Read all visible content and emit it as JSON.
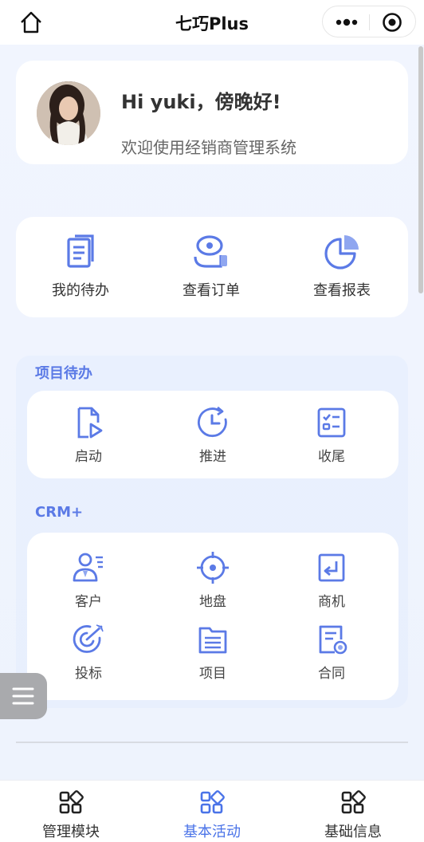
{
  "header": {
    "title": "七巧Plus",
    "more_icon": "more-dots-icon",
    "target_icon": "target-icon",
    "home_icon": "home-icon"
  },
  "greeting": {
    "title": "Hi yuki，傍晚好!",
    "subtitle": "欢迎使用经销商管理系统"
  },
  "quick_actions": [
    {
      "label": "我的待办",
      "icon": "todo-document-icon"
    },
    {
      "label": "查看订单",
      "icon": "order-icon"
    },
    {
      "label": "查看报表",
      "icon": "pie-chart-icon"
    }
  ],
  "project_todo": {
    "title": "项目待办",
    "items": [
      {
        "label": "启动",
        "icon": "start-file-icon"
      },
      {
        "label": "推进",
        "icon": "clock-progress-icon"
      },
      {
        "label": "收尾",
        "icon": "checklist-icon"
      }
    ]
  },
  "crm": {
    "title": "CRM+",
    "items": [
      {
        "label": "客户",
        "icon": "customer-icon"
      },
      {
        "label": "地盘",
        "icon": "territory-target-icon"
      },
      {
        "label": "商机",
        "icon": "opportunity-icon"
      },
      {
        "label": "投标",
        "icon": "bid-icon"
      },
      {
        "label": "项目",
        "icon": "project-folder-icon"
      },
      {
        "label": "合同",
        "icon": "contract-icon"
      }
    ]
  },
  "tabbar": [
    {
      "label": "管理模块",
      "icon": "grid-icon",
      "active": false
    },
    {
      "label": "基本活动",
      "icon": "grid-icon",
      "active": true
    },
    {
      "label": "基础信息",
      "icon": "grid-icon",
      "active": false
    }
  ],
  "colors": {
    "accent": "#4a73e8",
    "icon_blue": "#5b7ae6",
    "background": "#eef3fd"
  }
}
